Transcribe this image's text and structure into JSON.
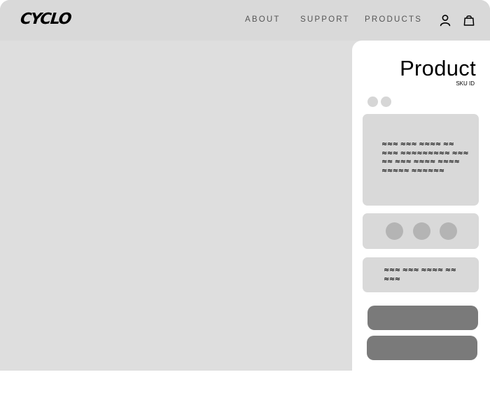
{
  "header": {
    "logo": "CYCLO",
    "nav": [
      {
        "label": "ABOUT"
      },
      {
        "label": "SUPPORT"
      },
      {
        "label": "PRODUCTS"
      }
    ],
    "icons": [
      "user-icon",
      "bag-icon"
    ]
  },
  "product": {
    "title": "Product",
    "sku": "SKU ID",
    "description": "≈≈≈ ≈≈≈ ≈≈≈≈ ≈≈ ≈≈≈ ≈≈≈≈≈≈≈≈≈ ≈≈≈ ≈≈ ≈≈≈ ≈≈≈≈ ≈≈≈≈ ≈≈≈≈≈ ≈≈≈≈≈≈",
    "note": "≈≈≈ ≈≈≈ ≈≈≈≈ ≈≈ ≈≈≈"
  },
  "colors": {
    "frame": "#dedede",
    "card": "#d9d9d9",
    "dot": "#b4b4b4",
    "button": "#7a7a7a"
  }
}
